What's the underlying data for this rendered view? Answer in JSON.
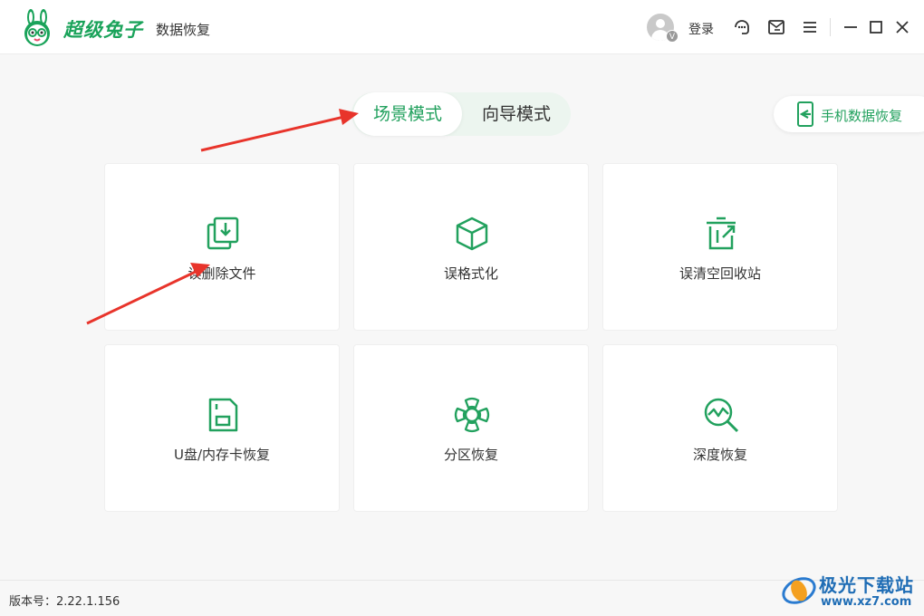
{
  "app": {
    "brand_name": "超级兔子",
    "brand_sub": "数据恢复"
  },
  "titlebar": {
    "login_label": "登录",
    "avatar_badge": "V",
    "icons": [
      "support-icon",
      "message-icon",
      "menu-icon",
      "minimize-icon",
      "maximize-icon",
      "close-icon"
    ]
  },
  "mode_switch": {
    "active_label": "场景模式",
    "inactive_label": "向导模式"
  },
  "phone_recovery": {
    "label": "手机数据恢复"
  },
  "cards": [
    {
      "label": "误删除文件",
      "icon": "file-restore-icon"
    },
    {
      "label": "误格式化",
      "icon": "box-icon"
    },
    {
      "label": "误清空回收站",
      "icon": "recycle-bin-icon"
    },
    {
      "label": "U盘/内存卡恢复",
      "icon": "sd-card-icon"
    },
    {
      "label": "分区恢复",
      "icon": "partition-icon"
    },
    {
      "label": "深度恢复",
      "icon": "deep-scan-icon"
    }
  ],
  "footer": {
    "version": "版本号：2.22.1.156"
  },
  "watermark": {
    "title": "极光下载站",
    "url": "www.xz7.com"
  },
  "colors": {
    "accent": "#22a15e",
    "annotation_arrow": "#e8342b"
  }
}
